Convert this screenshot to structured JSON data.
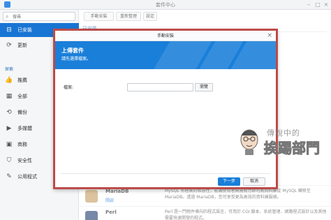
{
  "window": {
    "title": "套件中心",
    "controls": [
      "minimize",
      "maximize",
      "close"
    ]
  },
  "sidebar": {
    "search_placeholder": "搜尋",
    "items": [
      {
        "label": "已安裝",
        "icon": "installed-icon",
        "active": true
      },
      {
        "label": "更新",
        "icon": "update-icon",
        "active": false
      }
    ],
    "explore_label": "探索",
    "explore_items": [
      {
        "label": "推薦",
        "icon": "thumbs-up-icon"
      },
      {
        "label": "全部",
        "icon": "grid-icon"
      },
      {
        "label": "備份",
        "icon": "backup-icon"
      },
      {
        "label": "多媒體",
        "icon": "multimedia-icon"
      },
      {
        "label": "商務",
        "icon": "briefcase-icon"
      },
      {
        "label": "安全性",
        "icon": "shield-icon"
      },
      {
        "label": "公用程式",
        "icon": "tools-icon"
      }
    ]
  },
  "toolbar": {
    "manual_install": "手動安裝",
    "refresh": "重新整理",
    "settings": "設定"
  },
  "main": {
    "installed_header": "已安裝",
    "packages": [
      {
        "name": "MariaDB",
        "link": "開啟",
        "desc": "MySQL 有極高的相容性，能讓使用者無需費力即可將資料庫從 MySQL 轉移至 MariaDB。透過 MariaDB，您可享受更為高效的資料庫服務。"
      },
      {
        "name": "Perl",
        "link": "",
        "desc": "Perl 是一門物件導向的程式語言，可用於 CGI 腳本、系統管理、網路程式設計以及其他需要快速開發的程式。"
      }
    ]
  },
  "dialog": {
    "title": "手動安裝",
    "banner_title": "上傳套件",
    "banner_subtitle": "請先選擇檔案。",
    "file_label": "檔案:",
    "browse_button": "瀏覽",
    "next_button": "下一步",
    "cancel_button": "取消"
  },
  "watermark": {
    "line1": "傳說中的",
    "line2": "挨踢部門"
  },
  "colors": {
    "accent": "#1875d4",
    "banner": "#1a7fd9",
    "highlight_border": "#b94a48"
  }
}
